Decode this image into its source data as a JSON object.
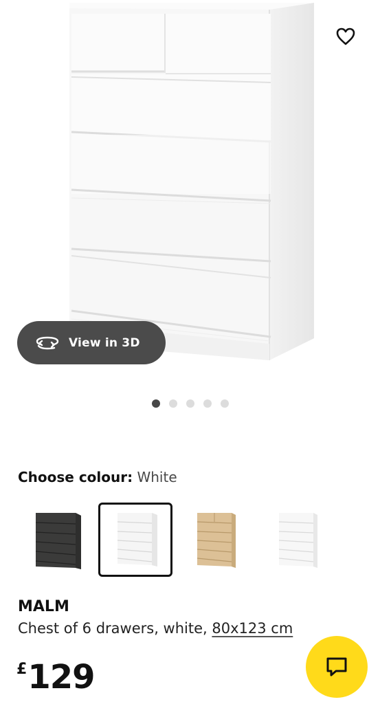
{
  "gallery": {
    "view_3d_label": "View in 3D",
    "dot_count": 5,
    "active_dot": 0
  },
  "colour": {
    "label": "Choose colour:",
    "selected": "White",
    "options": [
      {
        "name": "black-brown",
        "color": "#3b3b3a"
      },
      {
        "name": "white",
        "color": "#f3f3f3",
        "selected": true
      },
      {
        "name": "white stained oak veneer",
        "color": "#dcc096"
      },
      {
        "name": "high-gloss white",
        "color": "#f7f7f7"
      }
    ]
  },
  "product": {
    "name": "MALM",
    "description": "Chest of 6 drawers, white, ",
    "size": "80x123 cm",
    "currency": "£",
    "price": "129"
  },
  "colors": {
    "view_3d_bg": "#4b4b4b",
    "chat_bg": "#ffda1a",
    "active_dot": "#484848",
    "inactive_dot": "#dcdcdc"
  }
}
